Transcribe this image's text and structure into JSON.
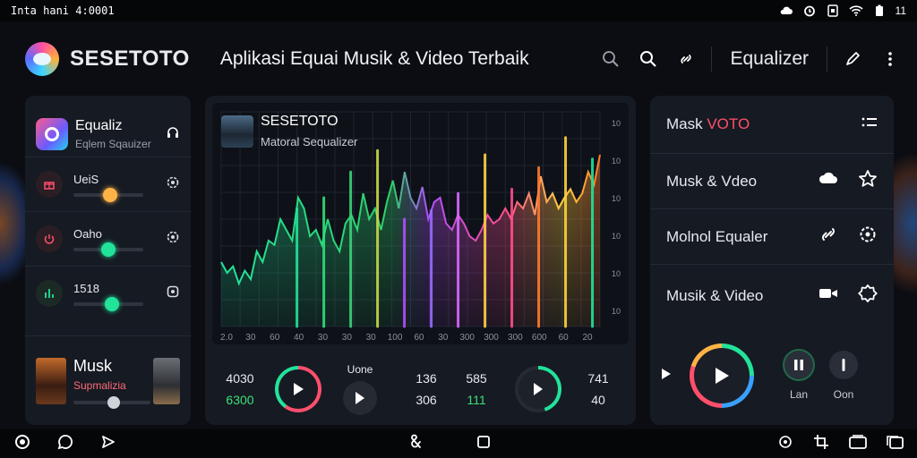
{
  "status": {
    "time_text": "Inta hani 4:0001",
    "battery_text": "11"
  },
  "header": {
    "brand": "SESETOTO",
    "headline": "Aplikasi Equai Musik & Video Terbaik",
    "right_title": "Equalizer"
  },
  "left_panel": {
    "title": "Equaliz",
    "subtitle": "Eqlem Sqauizer",
    "sliders": [
      {
        "label": "UeiS",
        "value": 0.52,
        "color": "#ffb347"
      },
      {
        "label": "Oaho",
        "value": 0.5,
        "color": "#22e39a"
      },
      {
        "label": "1518",
        "value": 0.55,
        "color": "#22e39a"
      }
    ],
    "now_playing": {
      "title": "Musk",
      "subtitle": "Supmalizia"
    }
  },
  "center_panel": {
    "title": "SESETOTO",
    "subtitle": "Matoral Sequalizer",
    "x_ticks": [
      "2.0",
      "30",
      "60",
      "40",
      "30",
      "30",
      "30",
      "100",
      "60",
      "30",
      "300",
      "300",
      "300",
      "600",
      "60",
      "20"
    ],
    "y_ticks": [
      "10",
      "10",
      "10",
      "10",
      "10",
      "10"
    ],
    "spectrum": [
      0.3,
      0.25,
      0.28,
      0.2,
      0.26,
      0.22,
      0.35,
      0.3,
      0.4,
      0.38,
      0.5,
      0.45,
      0.4,
      0.6,
      0.55,
      0.42,
      0.45,
      0.38,
      0.5,
      0.4,
      0.35,
      0.48,
      0.52,
      0.45,
      0.62,
      0.5,
      0.55,
      0.45,
      0.58,
      0.68,
      0.55,
      0.72,
      0.6,
      0.55,
      0.65,
      0.5,
      0.58,
      0.6,
      0.48,
      0.45,
      0.52,
      0.48,
      0.42,
      0.4,
      0.45,
      0.52,
      0.48,
      0.5,
      0.55,
      0.5,
      0.58,
      0.55,
      0.62,
      0.52,
      0.7,
      0.58,
      0.62,
      0.55,
      0.6,
      0.64,
      0.58,
      0.62,
      0.72,
      0.66,
      0.8
    ],
    "peaks": [
      0.55,
      0.6,
      0.72,
      0.82,
      0.5,
      0.54,
      0.62,
      0.8,
      0.64,
      0.74,
      0.88,
      0.78
    ],
    "controls": {
      "c1_top": "4030",
      "c1_bottom": "6300",
      "c2_top": "Uone",
      "c3_top": "136",
      "c3_bottom": "306",
      "c4_top": "585",
      "c4_bottom": "111",
      "c5_top": "741",
      "c5_bottom": "40"
    }
  },
  "right_panel": {
    "rows": [
      {
        "label": "Mask ",
        "accent": "VOTO"
      },
      {
        "label": "Musk & Vdeo"
      },
      {
        "label": "Molnol Equaler"
      },
      {
        "label": "Musik & Video"
      }
    ],
    "pause_label": "Lan",
    "stop_label": "Oon"
  },
  "colors": {
    "accent_green": "#22e39a",
    "accent_red": "#ff4f6d",
    "accent_orange": "#ffb347"
  }
}
